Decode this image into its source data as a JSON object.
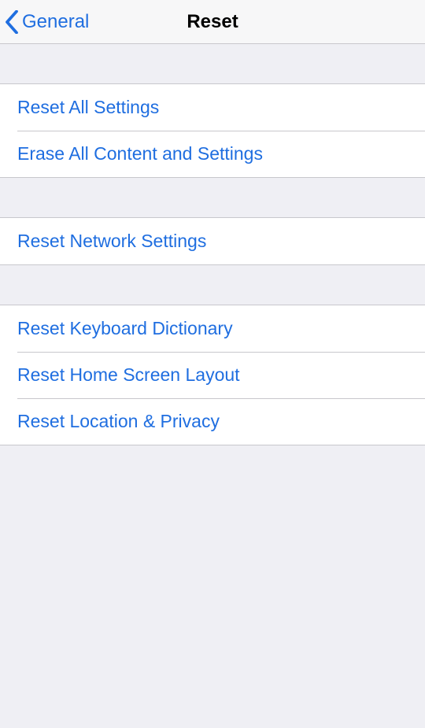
{
  "nav": {
    "back_label": "General",
    "title": "Reset"
  },
  "groups": [
    {
      "items": [
        {
          "id": "reset-all-settings",
          "label": "Reset All Settings"
        },
        {
          "id": "erase-all-content-settings",
          "label": "Erase All Content and Settings"
        }
      ]
    },
    {
      "items": [
        {
          "id": "reset-network-settings",
          "label": "Reset Network Settings"
        }
      ]
    },
    {
      "items": [
        {
          "id": "reset-keyboard-dictionary",
          "label": "Reset Keyboard Dictionary"
        },
        {
          "id": "reset-home-screen-layout",
          "label": "Reset Home Screen Layout"
        },
        {
          "id": "reset-location-privacy",
          "label": "Reset Location & Privacy"
        }
      ]
    }
  ]
}
